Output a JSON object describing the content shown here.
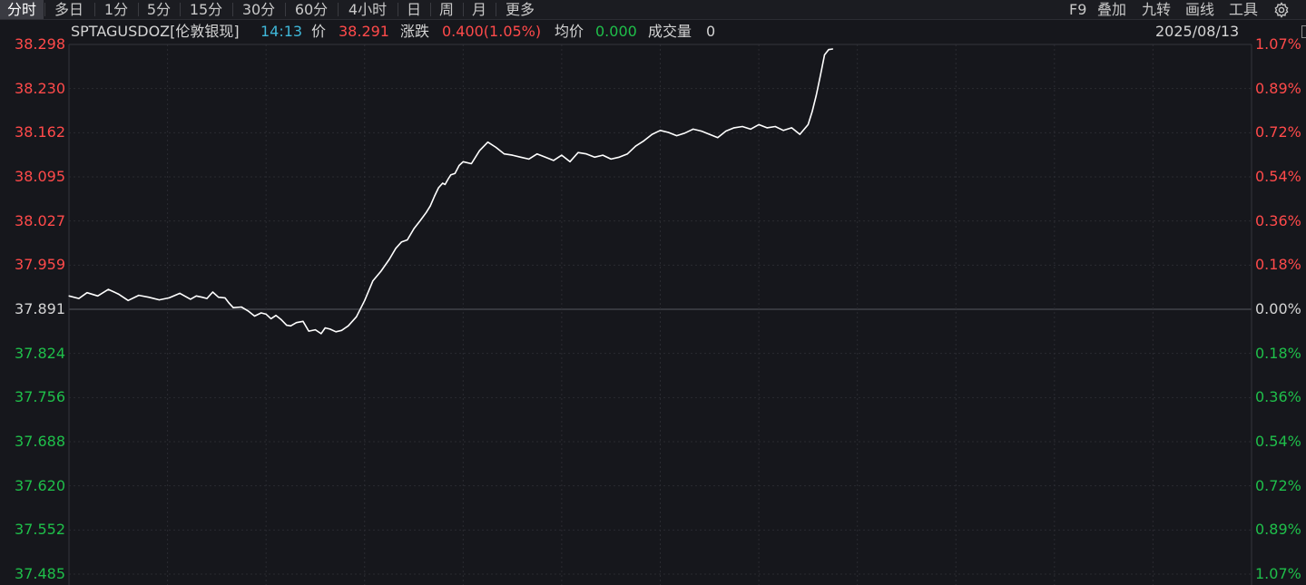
{
  "toolbar": {
    "tabs": [
      "分时",
      "多日",
      "1分",
      "5分",
      "15分",
      "30分",
      "60分",
      "4小时",
      "日",
      "周",
      "月",
      "更多"
    ],
    "active_tab": "分时",
    "tools": [
      "F9",
      "叠加",
      "九转",
      "画线",
      "工具"
    ],
    "settings_icon": "gear-icon"
  },
  "info": {
    "symbol": "SPTAGUSDOZ[伦敦银现]",
    "time": "14:13",
    "price_label": "价",
    "price": "38.291",
    "change_label": "涨跌",
    "change": "0.400(1.05%)",
    "avg_label": "均价",
    "avg": "0.000",
    "volume_label": "成交量",
    "volume": "0",
    "date": "2025/08/13"
  },
  "colors": {
    "up": "#ff4a4a",
    "down": "#1fbf4a",
    "neutral": "#d4d4d4",
    "time": "#3fb7d8",
    "line": "#ffffff",
    "grid": "#2a2b31",
    "background": "#16171c"
  },
  "chart_data": {
    "type": "line",
    "y_ticks": [
      "38.298",
      "38.230",
      "38.162",
      "38.095",
      "38.027",
      "37.959",
      "37.891",
      "37.824",
      "37.756",
      "37.688",
      "37.620",
      "37.552",
      "37.485"
    ],
    "pct_ticks": [
      "1.07%",
      "0.89%",
      "0.72%",
      "0.54%",
      "0.36%",
      "0.18%",
      "0.00%",
      "0.18%",
      "0.36%",
      "0.54%",
      "0.72%",
      "0.89%",
      "1.07%"
    ],
    "ylim": [
      37.485,
      38.298
    ],
    "base_price": 37.891,
    "x_slots": 1440,
    "x": [
      0,
      12,
      22,
      35,
      48,
      60,
      72,
      85,
      97,
      110,
      122,
      135,
      148,
      155,
      162,
      168,
      175,
      182,
      190,
      195,
      200,
      210,
      218,
      226,
      234,
      240,
      246,
      252,
      258,
      265,
      270,
      277,
      285,
      292,
      300,
      307,
      312,
      318,
      325,
      332,
      340,
      350,
      360,
      370,
      380,
      390,
      398,
      405,
      412,
      420,
      428,
      435,
      440,
      445,
      450,
      455,
      458,
      462,
      465,
      470,
      475,
      480,
      490,
      500,
      510,
      520,
      530,
      540,
      550,
      560,
      570,
      580,
      590,
      600,
      610,
      620,
      630,
      640,
      650,
      660,
      670,
      680,
      690,
      700,
      710,
      720,
      730,
      740,
      750,
      760,
      770,
      780,
      790,
      800,
      810,
      820,
      830,
      840,
      850,
      860,
      870,
      880,
      890,
      900,
      905,
      910,
      915,
      920,
      925,
      930
    ],
    "values": [
      37.912,
      37.908,
      37.917,
      37.912,
      37.922,
      37.915,
      37.905,
      37.913,
      37.91,
      37.906,
      37.909,
      37.916,
      37.907,
      37.912,
      37.91,
      37.908,
      37.918,
      37.91,
      37.909,
      37.901,
      37.894,
      37.895,
      37.889,
      37.881,
      37.886,
      37.884,
      37.877,
      37.882,
      37.876,
      37.867,
      37.866,
      37.871,
      37.873,
      37.858,
      37.86,
      37.854,
      37.863,
      37.861,
      37.857,
      37.859,
      37.866,
      37.88,
      37.905,
      37.935,
      37.95,
      37.968,
      37.985,
      37.995,
      37.998,
      38.015,
      38.028,
      38.04,
      38.05,
      38.065,
      38.078,
      38.085,
      38.083,
      38.092,
      38.098,
      38.1,
      38.112,
      38.118,
      38.115,
      38.135,
      38.148,
      38.14,
      38.13,
      38.128,
      38.125,
      38.122,
      38.13,
      38.125,
      38.12,
      38.128,
      38.118,
      38.132,
      38.13,
      38.125,
      38.128,
      38.122,
      38.125,
      38.13,
      38.142,
      38.15,
      38.16,
      38.166,
      38.163,
      38.158,
      38.162,
      38.168,
      38.165,
      38.16,
      38.155,
      38.165,
      38.17,
      38.172,
      38.168,
      38.175,
      38.17,
      38.172,
      38.166,
      38.17,
      38.16,
      38.175,
      38.195,
      38.22,
      38.25,
      38.282,
      38.29,
      38.291
    ]
  }
}
